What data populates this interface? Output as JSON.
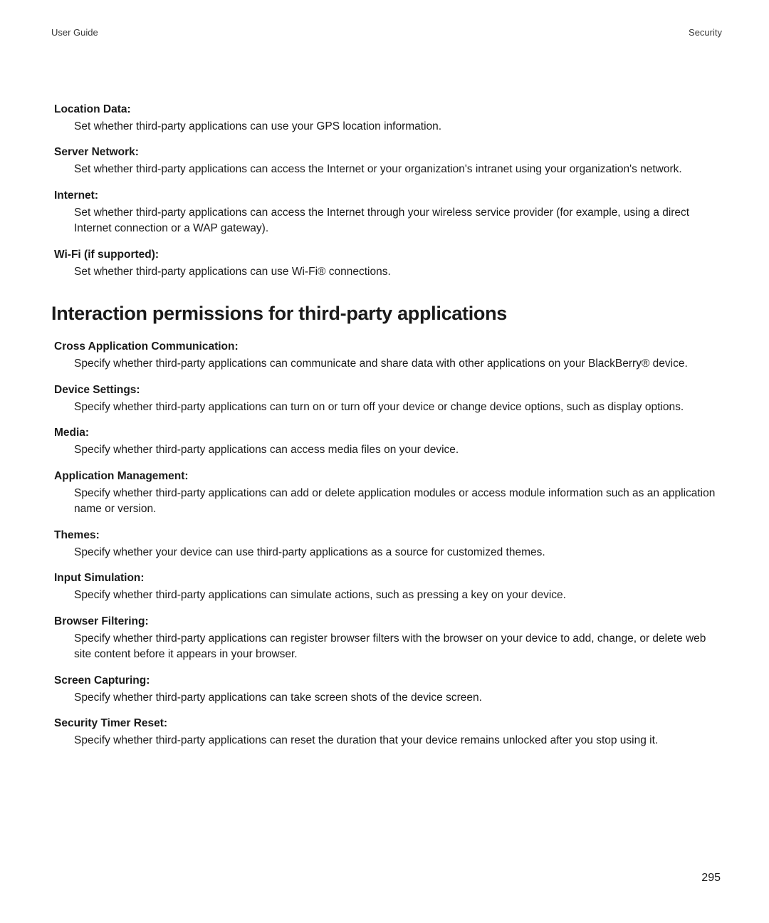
{
  "header": {
    "left": "User Guide",
    "right": "Security"
  },
  "section1": {
    "items": [
      {
        "label": "Location Data:",
        "desc": "Set whether third-party applications can use your GPS location information."
      },
      {
        "label": "Server Network:",
        "desc": "Set whether third-party applications can access the Internet or your organization's intranet using your organization's network."
      },
      {
        "label": "Internet:",
        "desc": "Set whether third-party applications can access the Internet through your wireless service provider (for example, using a direct Internet connection or a WAP gateway)."
      },
      {
        "label": "Wi-Fi (if supported):",
        "desc": "Set whether third-party applications can use Wi-Fi® connections."
      }
    ]
  },
  "section2": {
    "heading": "Interaction permissions for third-party applications",
    "items": [
      {
        "label": "Cross Application Communication:",
        "desc": "Specify whether third-party applications can communicate and share data with other applications on your BlackBerry® device."
      },
      {
        "label": "Device Settings:",
        "desc": "Specify whether third-party applications can turn on or turn off your device or change device options, such as display options."
      },
      {
        "label": "Media:",
        "desc": "Specify whether third-party applications can access media files on your device."
      },
      {
        "label": "Application Management:",
        "desc": "Specify whether third-party applications can add or delete application modules or access module information such as an application name or version."
      },
      {
        "label": "Themes:",
        "desc": "Specify whether your device can use third-party applications as a source for customized themes."
      },
      {
        "label": "Input Simulation:",
        "desc": "Specify whether third-party applications can simulate actions, such as pressing a key on your device."
      },
      {
        "label": "Browser Filtering:",
        "desc": "Specify whether third-party applications can register browser filters with the browser on your device to add, change, or delete web site content before it appears in your browser."
      },
      {
        "label": "Screen Capturing:",
        "desc": "Specify whether third-party applications can take screen shots of the device screen."
      },
      {
        "label": "Security Timer Reset:",
        "desc": "Specify whether third-party applications can reset the duration that your device remains unlocked after you stop using it."
      }
    ]
  },
  "pageNumber": "295"
}
